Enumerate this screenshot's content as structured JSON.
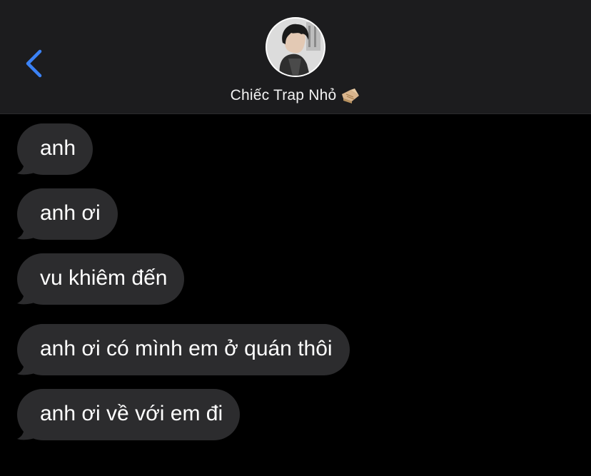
{
  "header": {
    "back_icon": "chevron-left-icon",
    "contact_name": "Chiếc Trap Nhỏ",
    "contact_emoji_icon": "pointing-hand-icon",
    "avatar_icon": "contact-photo",
    "colors": {
      "accent": "#3b82f6",
      "header_bg": "#1c1c1e",
      "bubble": "#2c2c2e"
    }
  },
  "messages": [
    {
      "text": "anh"
    },
    {
      "text": "anh ơi"
    },
    {
      "text": "vu khiêm đến"
    },
    {
      "text": "anh ơi có mình em ở quán thôi"
    },
    {
      "text": "anh ơi về với em đi"
    }
  ]
}
